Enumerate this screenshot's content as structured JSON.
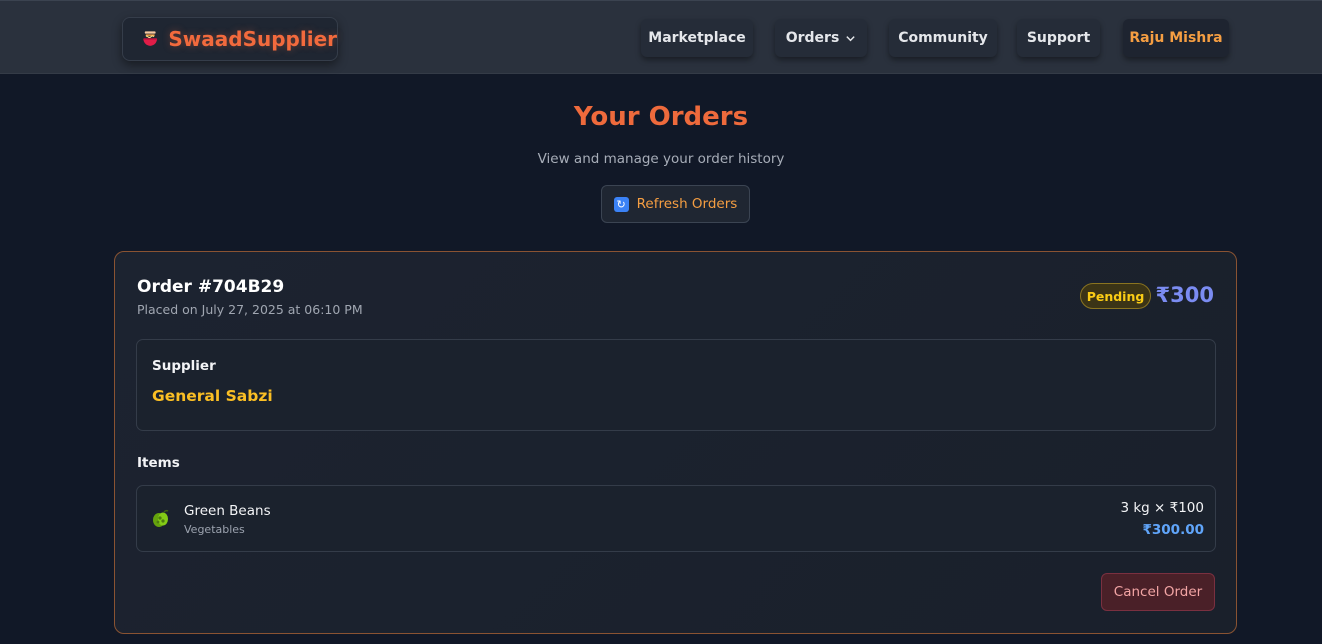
{
  "brand": {
    "name": "SwaadSupplier",
    "icon": "noodle-bowl-icon"
  },
  "nav": {
    "marketplace": "Marketplace",
    "orders": "Orders",
    "community": "Community",
    "support": "Support",
    "user": "Raju Mishra"
  },
  "header": {
    "title": "Your Orders",
    "subtitle": "View and manage your order history",
    "refresh_label": "Refresh Orders",
    "refresh_icon": "refresh-icon"
  },
  "order": {
    "id": "Order #704B29",
    "placed": "Placed on July 27, 2025 at 06:10 PM",
    "status": "Pending",
    "total": "₹300",
    "supplier_label": "Supplier",
    "supplier_name": "General Sabzi",
    "items_label": "Items",
    "items": [
      {
        "name": "Green Beans",
        "category": "Vegetables",
        "quantity_price": "3 kg × ₹100",
        "subtotal": "₹300.00",
        "icon": "green-beans-icon"
      }
    ],
    "cancel_label": "Cancel Order"
  },
  "colors": {
    "accent": "#ee6a3c",
    "status_pending": "#facc15",
    "supplier": "#fbbf24",
    "total": "#7b8cf2",
    "subtotal": "#60a5fa",
    "card_border": "#8a5332"
  }
}
